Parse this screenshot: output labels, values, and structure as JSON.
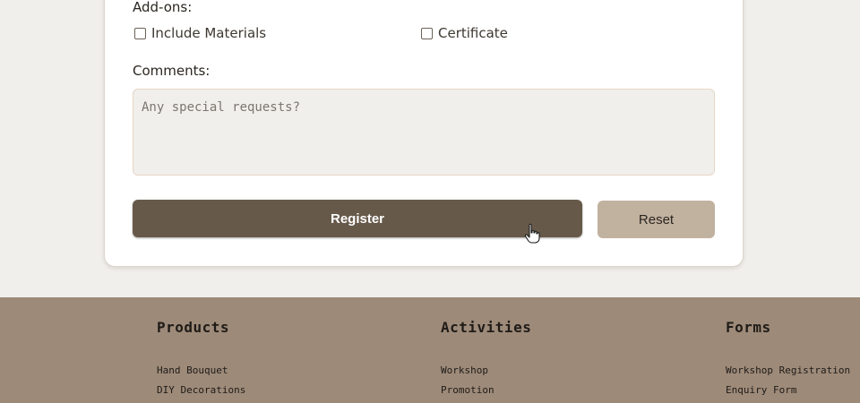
{
  "form": {
    "addons_label": "Add-ons:",
    "addons": [
      {
        "label": "Include Materials",
        "checked": false
      },
      {
        "label": "Certificate",
        "checked": false
      }
    ],
    "comments_label": "Comments:",
    "comments_placeholder": "Any special requests?",
    "comments_value": "",
    "register_label": "Register",
    "reset_label": "Reset"
  },
  "colors": {
    "page_background": "#f1efeb",
    "register_button": "#67594a",
    "reset_button": "#c1b19f",
    "footer_background": "#9d8a79"
  },
  "footer": {
    "columns": [
      {
        "heading": "Products",
        "links": [
          "Hand Bouquet",
          "DIY Decorations"
        ]
      },
      {
        "heading": "Activities",
        "links": [
          "Workshop",
          "Promotion"
        ]
      },
      {
        "heading": "Forms",
        "links": [
          "Workshop Registration",
          "Enquiry Form"
        ]
      }
    ]
  }
}
